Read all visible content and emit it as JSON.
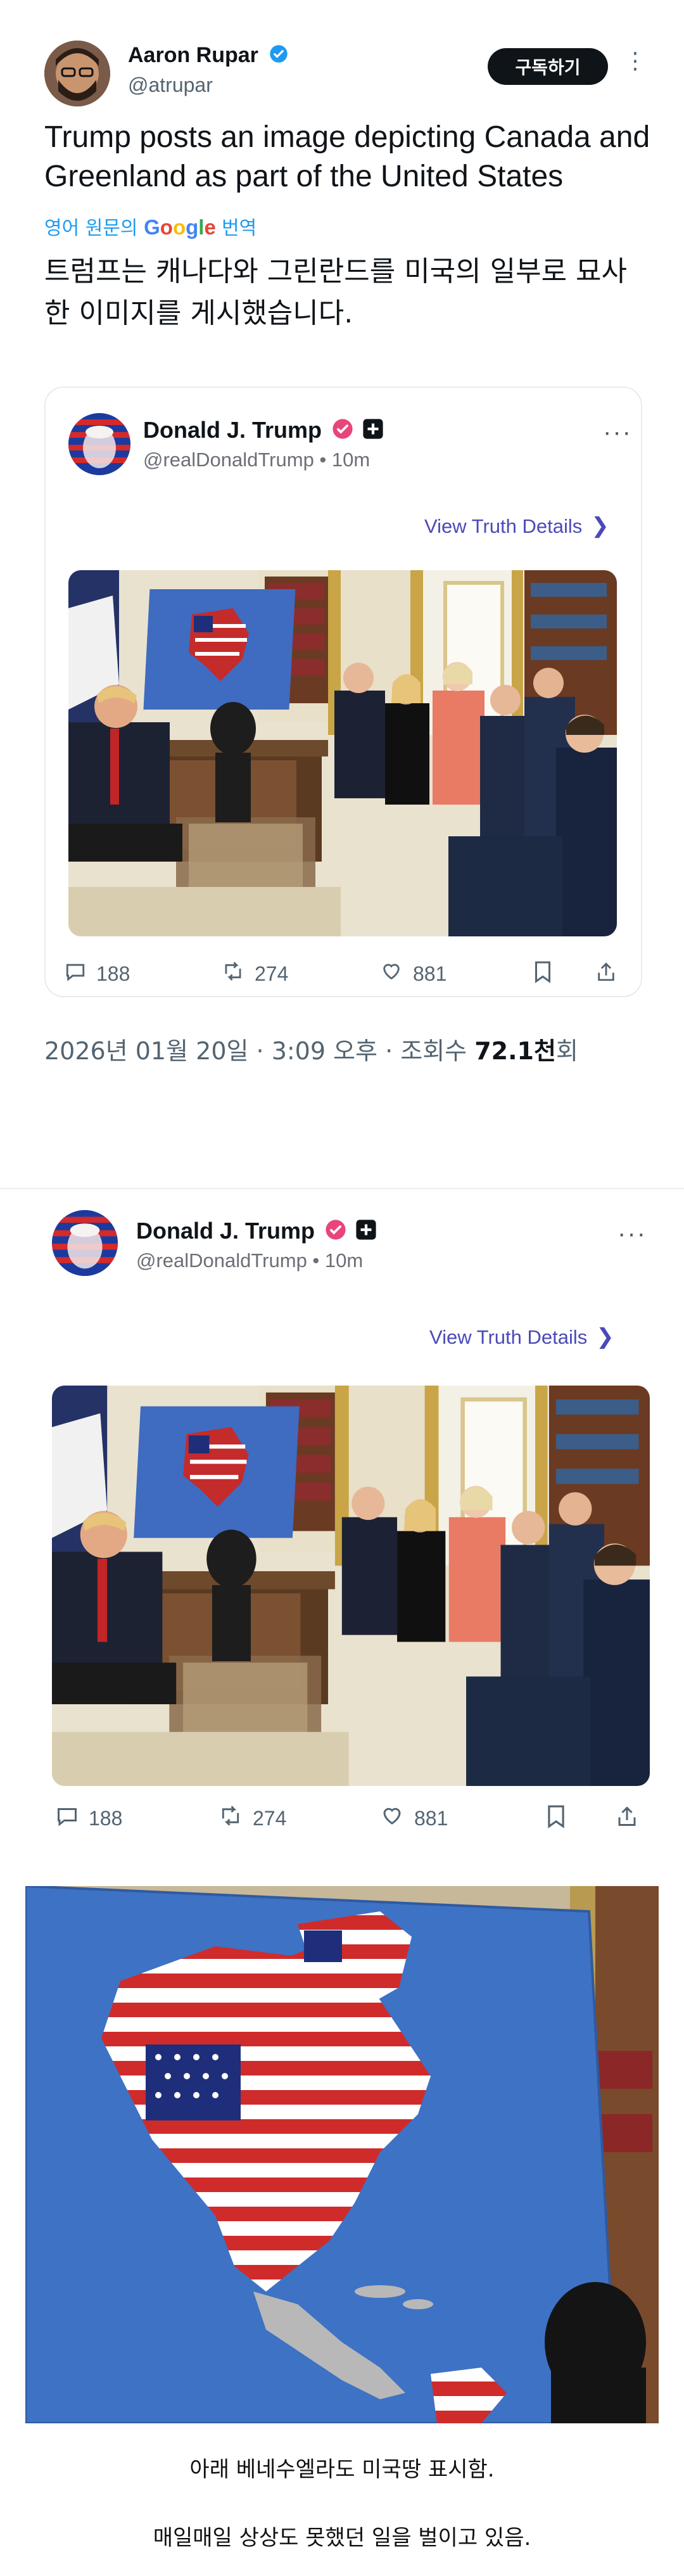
{
  "tweet": {
    "author_name": "Aaron Rupar",
    "author_handle": "@atrupar",
    "subscribe_label": "구독하기",
    "more_icon": "⋮",
    "text": "Trump posts an image depicting Canada and Greenland as part of the United States",
    "translate_prefix": "영어 원문의",
    "translate_google": "Google",
    "translate_suffix": "번역",
    "translated_text": "트럼프는 캐나다와 그린란드를 미국의 일부로 묘사한 이미지를 게시했습니다.",
    "date_prefix": "2026년 01월 20일 · 3:09 오후 · 조회수 ",
    "views_value": "72.1천",
    "views_suffix": "회"
  },
  "quote": {
    "name": "Donald J. Trump",
    "handle_time": "@realDonaldTrump • 10m",
    "more": "···",
    "view_details": "View Truth Details",
    "comments": "188",
    "retruths": "274",
    "likes": "881"
  },
  "post2": {
    "name": "Donald J. Trump",
    "handle_time": "@realDonaldTrump • 10m",
    "more": "···",
    "view_details": "View Truth Details",
    "comments": "188",
    "retruths": "274",
    "likes": "881"
  },
  "captions": {
    "line1": "아래 베네수엘라도 미국땅 표시함.",
    "line2": "매일매일 상상도 못했던 일을 벌이고 있음."
  },
  "colors": {
    "accent_blue": "#1d9bf0",
    "truth_purple": "#4b4ab8",
    "verified_pink": "#e8457a"
  }
}
